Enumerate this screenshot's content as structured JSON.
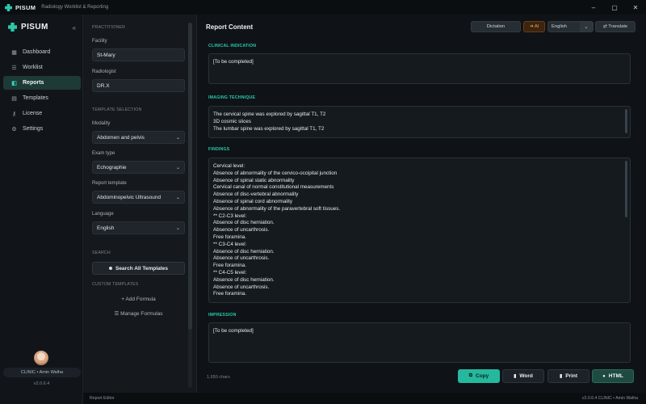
{
  "titlebar": {
    "app": "PISUM",
    "subtitle": "Radiology Worklist & Reporting",
    "min": "–",
    "max": "▢",
    "close": "✕"
  },
  "nav": {
    "brand": "PISUM",
    "collapse": "«",
    "items": [
      {
        "label": "Dashboard",
        "icon": "dashboard-icon",
        "glyph": "▦"
      },
      {
        "label": "Worklist",
        "icon": "list-icon",
        "glyph": "☰"
      },
      {
        "label": "Reports",
        "icon": "report-icon",
        "glyph": "◧"
      },
      {
        "label": "Templates",
        "icon": "template-icon",
        "glyph": "▤"
      },
      {
        "label": "License",
        "icon": "key-icon",
        "glyph": "⚷"
      },
      {
        "label": "Settings",
        "icon": "gear-icon",
        "glyph": "⚙"
      }
    ],
    "active": "Reports",
    "user": "CLINIC • Amin Walha",
    "version": "v2.0.6.4"
  },
  "panel": {
    "practitioner_header": "PRACTITIONER",
    "facility_label": "Facility",
    "facility_value": "St-Mary",
    "radiologist_label": "Radiologist",
    "radiologist_value": "DR.X",
    "template_header": "TEMPLATE SELECTION",
    "modality_label": "Modality",
    "modality_value": "Abdomen and pelvis",
    "exam_label": "Exam type",
    "exam_value": "Echographie",
    "report_template_label": "Report template",
    "report_template_value": "Abdominopelvic Ultrasound",
    "language_label": "Language",
    "language_value": "English",
    "search_header": "SEARCH",
    "search_button": "Search All Templates",
    "custom_header": "CUSTOM TEMPLATES",
    "add_formula": "+ Add Formula",
    "manage_formulas": "Manage Formulas",
    "caret": "⌄"
  },
  "main": {
    "title": "Report Content",
    "dictation": "Dictation",
    "ai": "➔ AI",
    "language": "English",
    "translate": "⇄ Translate",
    "sections": {
      "clinical_title": "CLINICAL INDICATION",
      "clinical_lines": [
        "[To be completed]"
      ],
      "imaging_title": "IMAGING TECHNIQUE",
      "imaging_lines": [
        "The cervical spine was explored by sagittal T1, T2",
        "3D cosmic slices",
        "The lumbar spine was explored by sagittal T1, T2"
      ],
      "findings_title": "FINDINGS",
      "findings_lines": [
        "Cervical level:",
        "Absence of abnormality of the cervico-occipital junction",
        "Absence of spinal static abnormality",
        "Cervical canal of normal constitutional measurements",
        "Absence of disc-vertebral abnormality",
        "Absence of spinal cord abnormality",
        "Absence of abnormality of the paravertebral soft tissues.",
        "** C2-C3 level:",
        "Absence of disc herniation.",
        "Absence of uncarthrosis.",
        "Free foramina.",
        "** C3-C4 level:",
        "Absence of disc herniation.",
        "Absence of uncarthrosis.",
        "Free foramina.",
        "** C4-C5 level:",
        "Absence of disc herniation.",
        "Absence of uncarthrosis.",
        "Free foramina."
      ],
      "impression_title": "IMPRESSION",
      "impression_lines": [
        "[To be completed]"
      ]
    },
    "chars": "1,650 chars",
    "copy": "Copy",
    "word": "Word",
    "print": "Print",
    "html": "HTML"
  },
  "status": {
    "left": "Report Editor",
    "right": "v2.0.6.4      CLINIC • Amin Walha"
  },
  "colors": {
    "accent": "#2bc7ab",
    "active_nav_bg": "#1e3a36",
    "ai_orange": "#f2a24a",
    "background": "#0e1114"
  }
}
